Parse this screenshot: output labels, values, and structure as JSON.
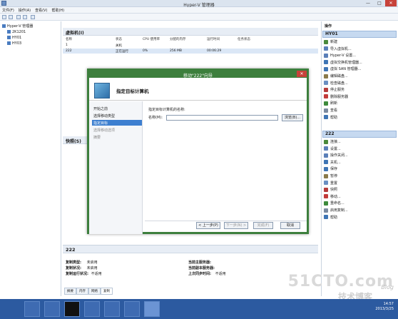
{
  "window": {
    "title": "Hyper-V 管理器",
    "minimize": "—",
    "maximize": "□",
    "close": "✕"
  },
  "menu": [
    "文件(F)",
    "操作(A)",
    "查看(V)",
    "帮助(H)"
  ],
  "tree": {
    "root": "Hyper-V 管理器",
    "hosts": [
      "2K1201",
      "HY01",
      "HY03"
    ]
  },
  "vm_panel": {
    "title": "虚拟机(I)",
    "columns": [
      "名称",
      "状态",
      "CPU 使用率",
      "分配的内存",
      "运行时间",
      "任务状态"
    ],
    "rows": [
      {
        "name": "1",
        "state": "关机",
        "cpu": "",
        "mem": "",
        "uptime": ""
      },
      {
        "name": "222",
        "state": "正在运行",
        "cpu": "0%",
        "mem": "256 MB",
        "uptime": "00:06:29"
      }
    ]
  },
  "snapshots_title": "快照(S)",
  "details": {
    "vm_name": "222",
    "left": [
      {
        "k": "复制类型:",
        "v": "未启用"
      },
      {
        "k": "复制状况:",
        "v": "未启用"
      },
      {
        "k": "复制运行状况:",
        "v": "不适用"
      }
    ],
    "right": [
      {
        "k": "当前主服务器:",
        "v": ""
      },
      {
        "k": "当前副本服务器:",
        "v": ""
      },
      {
        "k": "上次同步时间:",
        "v": "不适用"
      }
    ],
    "tabs": [
      "摘要",
      "内存",
      "网络",
      "复制"
    ]
  },
  "actions": {
    "title": "操作",
    "host_section": "HY01",
    "host_actions": [
      "新建",
      "导入虚拟机...",
      "Hyper-V 设置...",
      "虚拟交换机管理器...",
      "虚拟 SAN 管理器...",
      "编辑磁盘...",
      "检查磁盘...",
      "停止服务",
      "删除服务器",
      "刷新",
      "查看",
      "帮助"
    ],
    "vm_section": "222",
    "vm_actions": [
      "连接...",
      "设置...",
      "操作关闭...",
      "关机...",
      "保存",
      "暂停",
      "重置",
      "快照",
      "移动...",
      "重命名...",
      "启用复制...",
      "帮助"
    ],
    "colors": {
      "selected": "#c6d9f0",
      "accent": "#3d7f3d"
    }
  },
  "dialog": {
    "title": "移动\"222\"向导",
    "heading": "指定目标计算机",
    "steps": [
      "开始之前",
      "选择移动类型",
      "指定目标",
      "选择移动选项",
      "摘要"
    ],
    "current_step": 2,
    "prompt": "指定目标计算机的名称:",
    "name_label": "名称(M):",
    "name_value": "",
    "browse": "浏览(B)...",
    "prev": "< 上一步(P)",
    "next": "下一步(N) >",
    "finish": "完成(F)",
    "cancel": "取消"
  },
  "taskbar": {
    "time": "14:57",
    "date": "2013/3/25"
  },
  "watermark": {
    "site": "51CTO.com",
    "sub": "技术博客",
    "tag": "Blog"
  }
}
